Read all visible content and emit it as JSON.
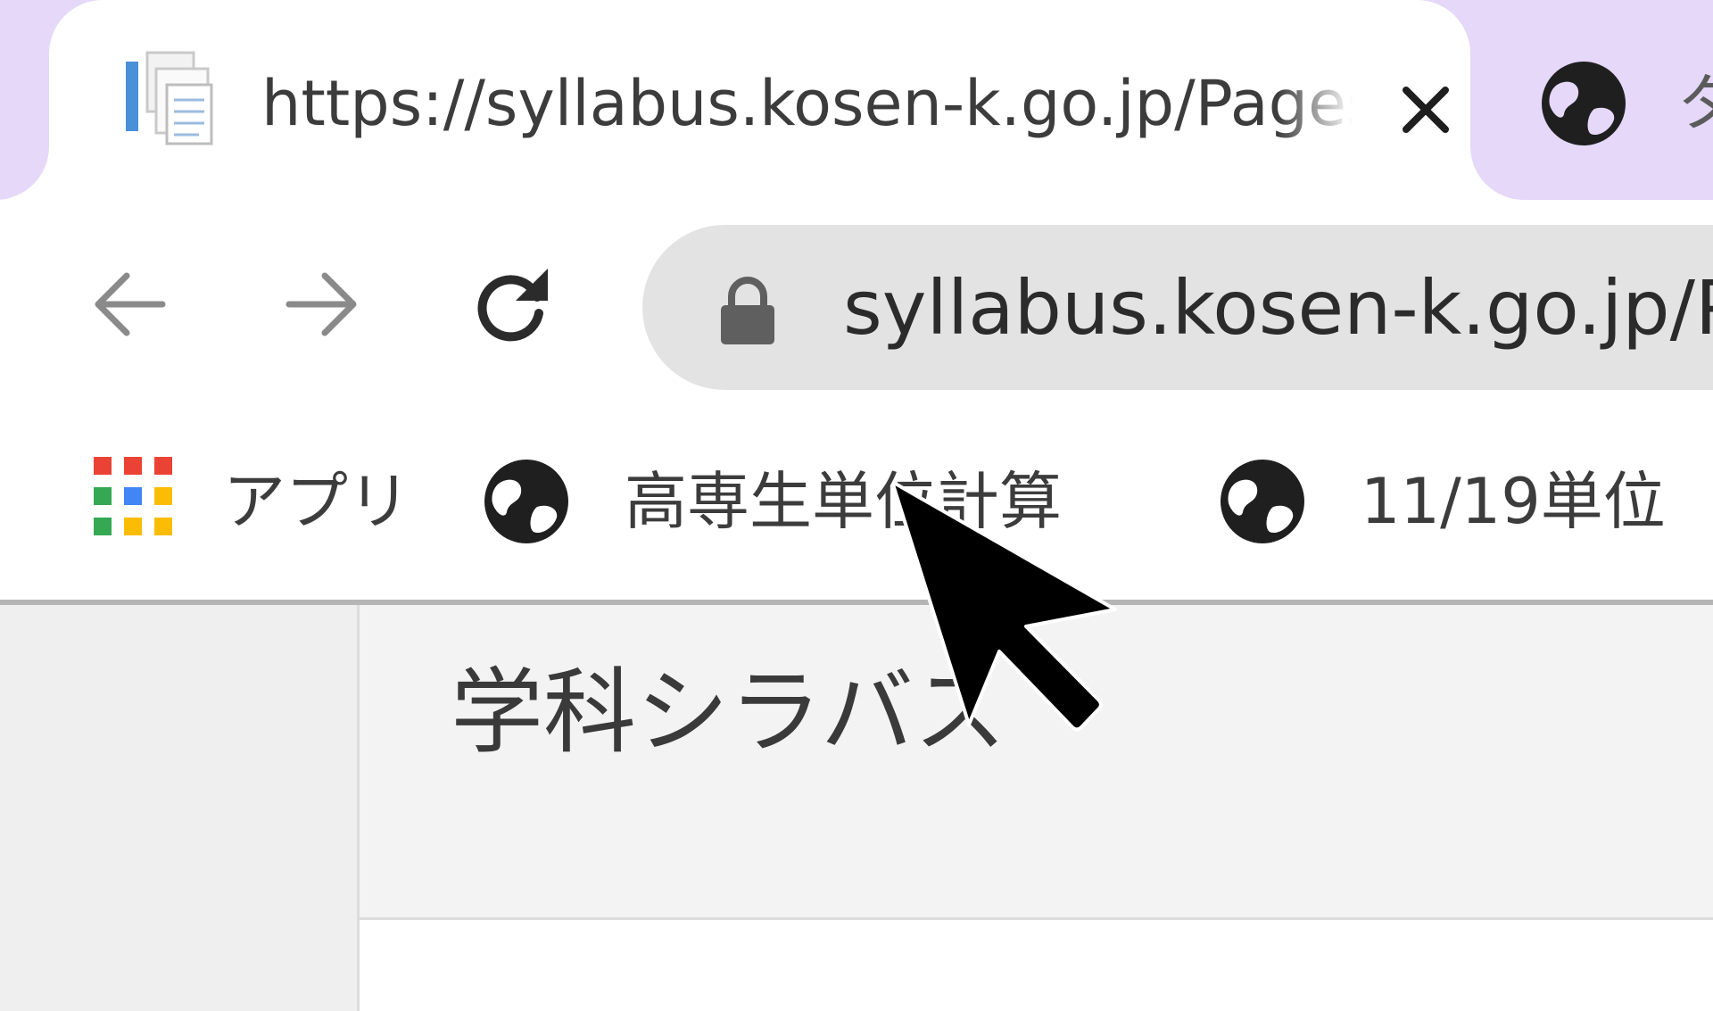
{
  "tabs": [
    {
      "title": "https://syllabus.kosen-k.go.jp/Pages/PublicSyllabus",
      "active": true,
      "favicon": "document-favicon-icon",
      "close_icon": "close-icon"
    },
    {
      "title": "タ",
      "active": false,
      "favicon": "globe-icon"
    }
  ],
  "toolbar": {
    "back_icon": "arrow-left-icon",
    "forward_icon": "arrow-right-icon",
    "reload_icon": "reload-icon",
    "security_icon": "lock-icon",
    "url": "syllabus.kosen-k.go.jp/P"
  },
  "bookmarks": [
    {
      "label": "アプリ",
      "icon": "apps-grid-icon"
    },
    {
      "label": "高専生単位計算",
      "icon": "globe-icon"
    },
    {
      "label": "11/19単位",
      "icon": "globe-icon"
    }
  ],
  "page": {
    "heading": "学科シラバス"
  },
  "colors": {
    "tab_strip": "#e5d8f8",
    "omnibox": "#e3e3e3",
    "page_bg": "#f3f3f3",
    "apps_red": "#ea4335",
    "apps_green": "#34a853",
    "apps_blue": "#4285f4",
    "apps_yellow": "#fbbc05"
  }
}
